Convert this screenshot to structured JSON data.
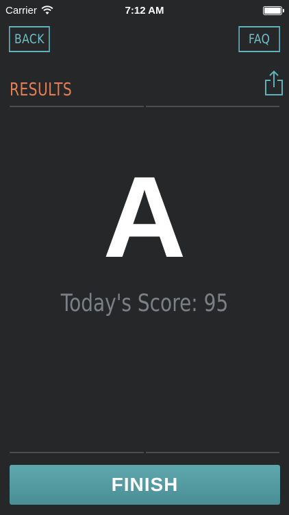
{
  "status_bar": {
    "carrier": "Carrier",
    "time": "7:12 AM",
    "battery_level": 1.0
  },
  "nav": {
    "back_label": "BACK",
    "faq_label": "FAQ"
  },
  "results": {
    "title": "RESULTS",
    "grade": "A",
    "score_text": "Today's Score: 95",
    "score_value": 95
  },
  "footer": {
    "finish_label": "FINISH"
  },
  "colors": {
    "background": "#262728",
    "accent_teal": "#5fb3bd",
    "title_orange": "#e47d54",
    "score_gray": "#7a8087",
    "finish_button": "#4f979e"
  },
  "icons": {
    "wifi": "wifi-icon",
    "battery": "battery-icon",
    "share": "share-icon"
  }
}
